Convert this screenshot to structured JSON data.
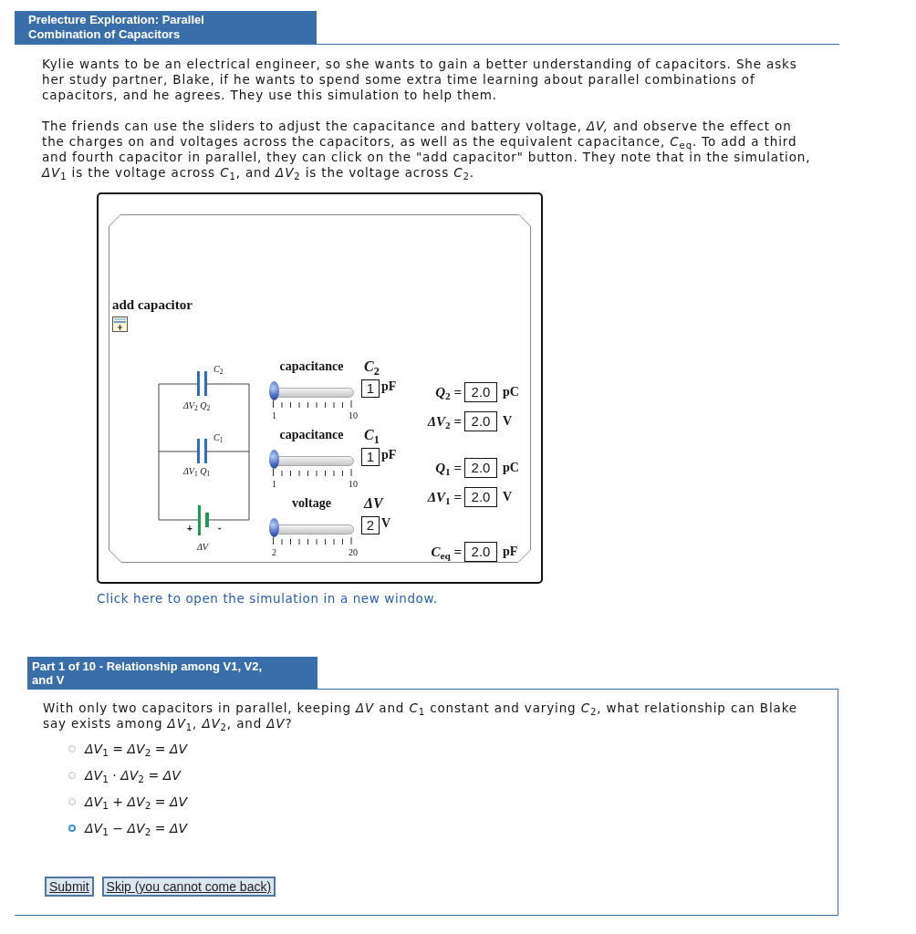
{
  "header": {
    "title": "Prelecture Exploration: Parallel Combination of Capacitors"
  },
  "intro": [
    "Kylie wants to be an electrical engineer, so she wants to gain a better understanding of capacitors. She asks her study partner, Blake, if he wants to spend some extra time learning about parallel combinations of capacitors, and he agrees. They use this simulation to help them.",
    "The friends can use the sliders to adjust the capacitance and battery voltage, *ΔV,* and observe the effect on the charges on and voltages across the capacitors, as well as the equivalent capacitance, *C*$_{eq}$. To add a third and fourth capacitor in parallel, they can click on the \"add capacitor\" button. They note that in the simulation, *ΔV*$_{1}$ is the voltage across *C*$_{1}$, and *ΔV*$_{2}$ is the voltage across *C*$_{2}$."
  ],
  "simulation": {
    "add_capacitor": {
      "label": "add capacitor"
    },
    "circuit": {
      "capacitors": [
        {
          "name": "*C*$_{2}$",
          "label": "*ΔV*$_{2}$ *Q*$_{2}$"
        },
        {
          "name": "*C*$_{1}$",
          "label": "*ΔV*$_{1}$ *Q*$_{1}$"
        }
      ],
      "battery": {
        "positive": "+",
        "negative": "-",
        "label": "*ΔV*"
      }
    },
    "sliders": [
      {
        "label": "capacitance",
        "symbol": "*C*$_{2}$",
        "value": "1",
        "unit": "pF",
        "level": 0,
        "min": "1",
        "max": "10"
      },
      {
        "label": "capacitance",
        "symbol": "*C*$_{1}$",
        "value": "1",
        "unit": "pF",
        "level": 0,
        "min": "1",
        "max": "10"
      },
      {
        "label": "voltage",
        "symbol": "*ΔV*",
        "value": "2",
        "unit": "V",
        "level": 0,
        "min": "2",
        "max": "20"
      }
    ],
    "readouts": [
      {
        "symbol": "*Q*$_{2}$ =",
        "value": "2.0",
        "unit": "pC"
      },
      {
        "symbol": "*ΔV*$_{2}$ =",
        "value": "2.0",
        "unit": "V"
      },
      {
        "symbol": "*Q*$_{1}$ =",
        "value": "2.0",
        "unit": "pC"
      },
      {
        "symbol": "*ΔV*$_{1}$ =",
        "value": "2.0",
        "unit": "V"
      },
      {
        "symbol": "*C*$_{eq}$ =",
        "value": "2.0",
        "unit": "pF"
      }
    ]
  },
  "simulation_link": "Click here to open the simulation in a new window.",
  "part": {
    "title": "Part 1 of 10 - Relationship among V1, V2, and V",
    "question": "With only two capacitors in parallel, keeping *ΔV* and *C*$_{1}$ constant and varying *C*$_{2}$, what relationship can Blake say exists among *ΔV*$_{1}$, *ΔV*$_{2}$, and *ΔV*?",
    "options": [
      {
        "text": "*ΔV*$_{1}$ = *ΔV*$_{2}$ = *ΔV*",
        "selected": false
      },
      {
        "text": "*ΔV*$_{1}$ · *ΔV*$_{2}$ = *ΔV*",
        "selected": false
      },
      {
        "text": "*ΔV*$_{1}$ + *ΔV*$_{2}$ = *ΔV*",
        "selected": false
      },
      {
        "text": "*ΔV*$_{1}$ − *ΔV*$_{2}$ = *ΔV*",
        "selected": true
      }
    ],
    "buttons": [
      "Submit",
      "Skip (you cannot come back)"
    ]
  }
}
